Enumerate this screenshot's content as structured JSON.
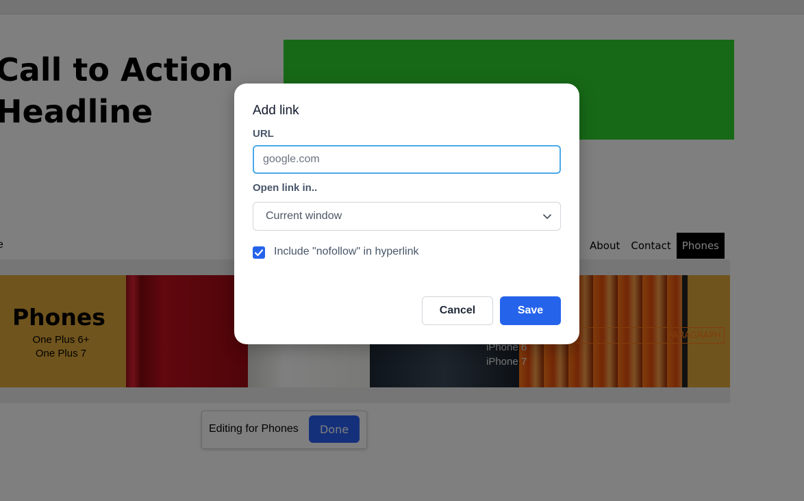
{
  "page": {
    "headline_line1": "Call to Action",
    "headline_line2": "Headline",
    "nav_partial": "e",
    "nav": [
      {
        "label": "About"
      },
      {
        "label": "Contact"
      },
      {
        "label": "Phones"
      }
    ],
    "hero": {
      "title": "Phones",
      "sub1": "One Plus 6+",
      "sub2": "One Plus 7",
      "iphone1": "iPhone 6",
      "iphone2": "iPhone 7",
      "paragraph_label": "PARAGRAPH"
    },
    "editing_bar": {
      "text": "Editing for Phones",
      "done_label": "Done"
    }
  },
  "modal": {
    "title": "Add link",
    "url_label": "URL",
    "url_value": "google.com",
    "open_in_label": "Open link in..",
    "open_in_selected": "Current window",
    "nofollow_label": "Include \"nofollow\" in hyperlink",
    "nofollow_checked": true,
    "cancel_label": "Cancel",
    "save_label": "Save"
  },
  "colors": {
    "accent": "#2563eb",
    "focus_border": "#4aa8e8",
    "green_box": "#2fd32f",
    "hero_bg": "#e0a93b"
  },
  "icons": {
    "select_arrow": "chevron-down-icon",
    "checkbox_mark": "check-icon"
  }
}
